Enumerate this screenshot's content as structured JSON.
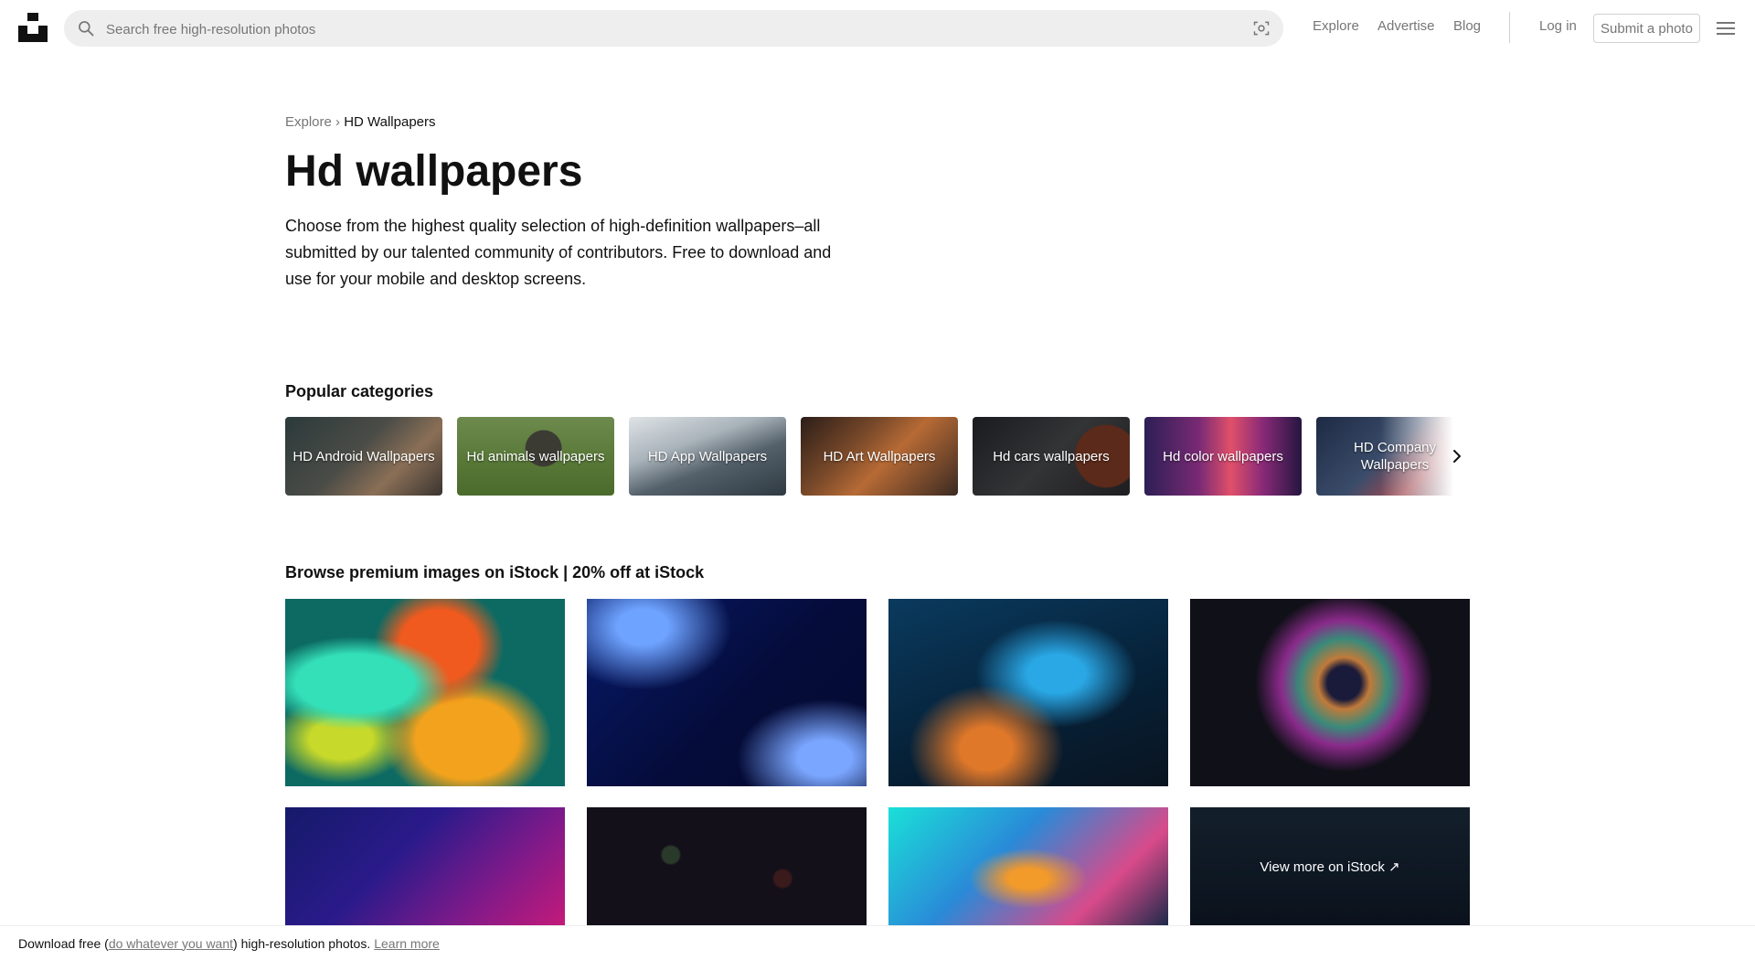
{
  "header": {
    "search_placeholder": "Search free high-resolution photos",
    "nav": [
      "Explore",
      "Advertise",
      "Blog"
    ],
    "login": "Log in",
    "submit": "Submit a photo"
  },
  "breadcrumb": {
    "parent": "Explore",
    "separator": "›",
    "current": "HD Wallpapers"
  },
  "page": {
    "title": "Hd wallpapers",
    "description": "Choose from the highest quality selection of high-definition wallpapers–all submitted by our talented community of contributors. Free to download and use for your mobile and desktop screens."
  },
  "popular": {
    "title": "Popular categories",
    "items": [
      "HD Android Wallpapers",
      "Hd animals wallpapers",
      "HD App Wallpapers",
      "HD Art Wallpapers",
      "Hd cars wallpapers",
      "Hd color wallpapers",
      "HD Company Wallpapers"
    ]
  },
  "istock": {
    "title_bold": "Browse premium images on iStock",
    "title_rest": "| 20% off at iStock",
    "view_more": "View more on iStock ↗"
  },
  "footer_bar": {
    "prefix": "Download free (",
    "link": "do whatever you want",
    "middle": ") high-resolution photos.",
    "learn_more": "Learn more"
  },
  "colors": {
    "text": "#111111",
    "muted": "#767676",
    "search_bg": "#eeeeee",
    "border": "#d1d1d1"
  },
  "icons": [
    "unsplash-logo-icon",
    "search-icon",
    "visual-search-icon",
    "menu-icon",
    "chevron-right-icon"
  ]
}
